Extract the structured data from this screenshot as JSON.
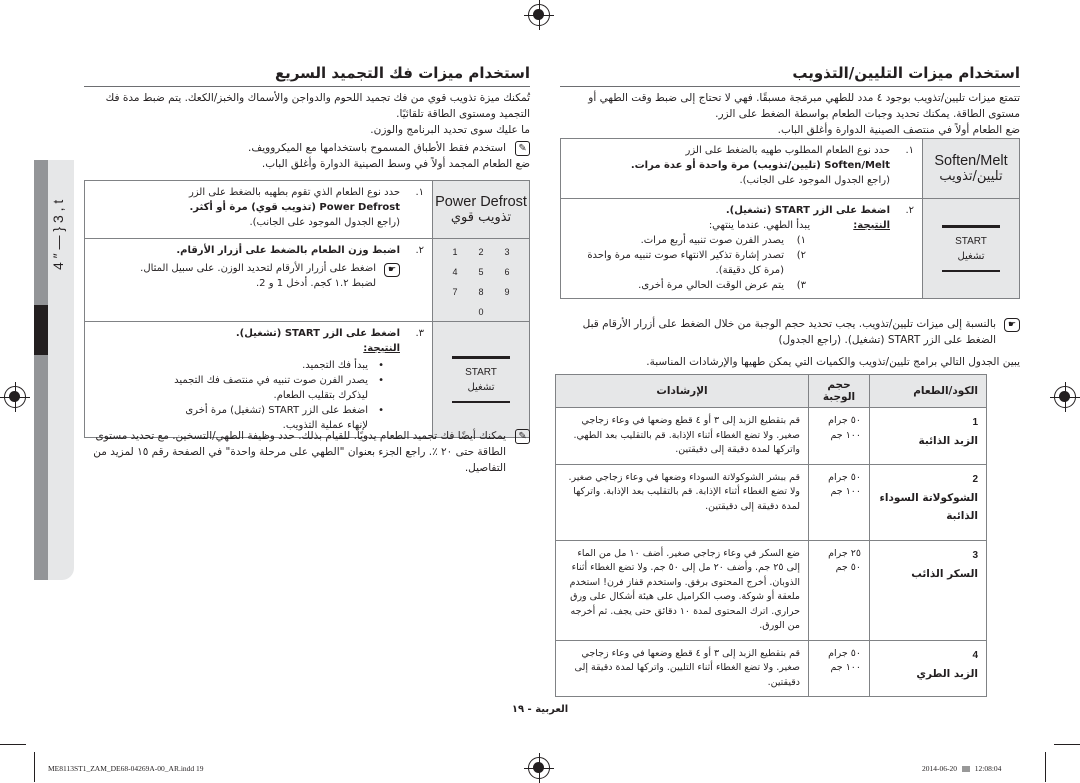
{
  "doc": {
    "page_footer": "العربية - ١٩",
    "slug_file": "ME8113ST1_ZAM_DE68-04269A-00_AR.indd   19",
    "slug_date": "2014-06-20",
    "slug_time": "12:08:04",
    "side_tab_text": "4 ″ — }  3  ,  t"
  },
  "right_section": {
    "title": "استخدام ميزات التليين/التذويب",
    "intro_1": "تتمتع ميزات تليين/تذويب بوجود ٤ مدد للطهي مبرمَجة مسبقًا. فهي لا تحتاج إلى ضبط وقت الطهي أو",
    "intro_2": "مستوى الطاقة. يمكنك تحديد وجبات الطعام بواسطة الضغط على الزر.",
    "intro_3": "ضع الطعام أولاً في منتصف الصينية الدوارة وأغلق الباب.",
    "steps": [
      {
        "num": "١.",
        "button_en": "Soften/Melt",
        "button_ar": "تليين/تذويب",
        "line_1": "حدد نوع الطعام المطلوب طهيه بالضغط على الزر",
        "line_2": "Soften/Melt (تليين/تذويب) مرة واحدة أو عدة مرات.",
        "line_3": "(راجع الجدول الموجود على الجانب)."
      },
      {
        "num": "٢.",
        "button_en": "START",
        "button_ar": "تشغيل",
        "line_1": "اضغط على الزر START (تشغيل).",
        "result_label": "النتيجة:",
        "result_text": "يبدأ الطهي. عندما ينتهي:",
        "sub": [
          {
            "n": "١)",
            "t": "يصدر الفرن صوت تنبيه أربع مرات."
          },
          {
            "n": "٢)",
            "t": "تصدر إشارة تذكير الانتهاء صوت تنبيه مرة واحدة (مرة كل دقيقة)."
          },
          {
            "n": "٣)",
            "t": "يتم عرض الوقت الحالي مرة أخرى."
          }
        ]
      }
    ],
    "note_1": "بالنسبة إلى ميزات تليين/تذويب. يجب تحديد حجم الوجبة من خلال الضغط على أزرار الأرقام قبل",
    "note_2": "الضغط على الزر START (تشغيل). (راجع الجدول)",
    "table_intro": "يبين الجدول التالي برامج تليين/تذويب والكميات التي يمكن طهيها والإرشادات المناسبة.",
    "table": {
      "headers": [
        "الكود/الطعام",
        "حجم الوجبة",
        "الإرشادات"
      ],
      "rows": [
        {
          "code": "1",
          "food": "الزبد الذائبة",
          "size_1": "٥٠ جرام",
          "size_2": "١٠٠ جم",
          "instructions": "قم بتقطيع الزبد إلى ٣ أو ٤ قطع وضعها في وعاء زجاجي صغير. ولا تضع الغطاء أثناء الإذابة. قم بالتقليب بعد الطهي. واتركها لمدة دقيقة إلى دقيقتين."
        },
        {
          "code": "2",
          "food": "الشوكولاتة السوداء الذائبة",
          "size_1": "٥٠ جرام",
          "size_2": "١٠٠ جم",
          "instructions": "قم ببشر الشوكولاتة السوداء وضعها في وعاء زجاجي صغير. ولا تضع الغطاء أثناء الإذابة. قم بالتقليب بعد الإذابة. واتركها لمدة دقيقة إلى دقيقتين."
        },
        {
          "code": "3",
          "food": "السكر الذائب",
          "size_1": "٢٥ جرام",
          "size_2": "٥٠ جم",
          "instructions": "ضع السكر في وعاء زجاجي صغير. أضف ١٠ مل من الماء إلى ٢٥ جم. وأضف ٢٠ مل إلى ٥٠ جم. ولا تضع الغطاء أثناء الذوبان. أخرج المحتوى برفق. واستخدم قفاز فرن! استخدم ملعقة أو شوكة. وصب الكراميل على هيئة أشكال على ورق حراري. اترك المحتوى لمدة ١٠ دقائق حتى يجف. ثم أخرجه من الورق."
        },
        {
          "code": "4",
          "food": "الزبد الطري",
          "size_1": "٥٠ جرام",
          "size_2": "١٠٠ جم",
          "instructions": "قم بتقطيع الزبد إلى ٣ أو ٤ قطع وضعها في وعاء زجاجي صغير. ولا تضع الغطاء أثناء التليين. واتركها لمدة دقيقة إلى دقيقتين."
        }
      ]
    }
  },
  "left_section": {
    "title": "استخدام ميزات فك التجميد السريع",
    "intro_1": "تُمكنك ميزة تذويب قوي من فك تجميد اللحوم والدواجن والأسماك والخبز/الكعك. يتم ضبط مدة فك",
    "intro_2": "التجميد ومستوى الطاقة تلقائيًا.",
    "intro_3": "ما عليك سوى تحديد البرنامج والوزن.",
    "note_dish": "استخدم فقط الأطباق المسموح باستخدامها مع الميكروويف.",
    "intro_4": "ضع الطعام المجمد أولاً في وسط الصينية الدوارة وأغلق الباب.",
    "steps": [
      {
        "num": "١.",
        "button_en": "Power Defrost",
        "button_ar": "تذويب قوي",
        "line_1": "حدد نوع الطعام الذي تقوم بطهيه بالضغط على الزر",
        "line_2": "Power Defrost (تذويب قوي) مرة أو أكثر.",
        "line_3": "(راجع الجدول الموجود على الجانب)."
      },
      {
        "num": "٢.",
        "keypad": [
          "1",
          "2",
          "3",
          "4",
          "5",
          "6",
          "7",
          "8",
          "9",
          "0"
        ],
        "line_1": "اضبط وزن الطعام بالضغط على أزرار الأرقام.",
        "tip_1": "اضغط على أزرار الأرقام لتحديد الوزن. على سبيل المثال.",
        "tip_2": "لضبط ١.٢ كجم. أدخل 1 و 2."
      },
      {
        "num": "٣.",
        "button_en": "START",
        "button_ar": "تشغيل",
        "line_1": "اضغط على الزر START (تشغيل).",
        "result_label": "النتيجة:",
        "bullets": [
          "يبدأ فك التجميد.",
          "يصدر الفرن صوت تنبيه في منتصف فك التجميد ليذكرك بتقليب الطعام.",
          "اضغط على الزر START (تشغيل) مرة أخرى لإنهاء عملية التذويب."
        ]
      }
    ],
    "manual_note_1": "يمكنك أيضًا فك تجميد الطعام يدويًا. للقيام بذلك. حدد وظيفة الطهي/التسخين. مع تحديد مستوى",
    "manual_note_2": "الطاقة حتى ٢٠ ٪. راجع الجزء بعنوان \"الطهي على مرحلة واحدة\" في الصفحة رقم ١٥ لمزيد من",
    "manual_note_3": "التفاصيل."
  }
}
